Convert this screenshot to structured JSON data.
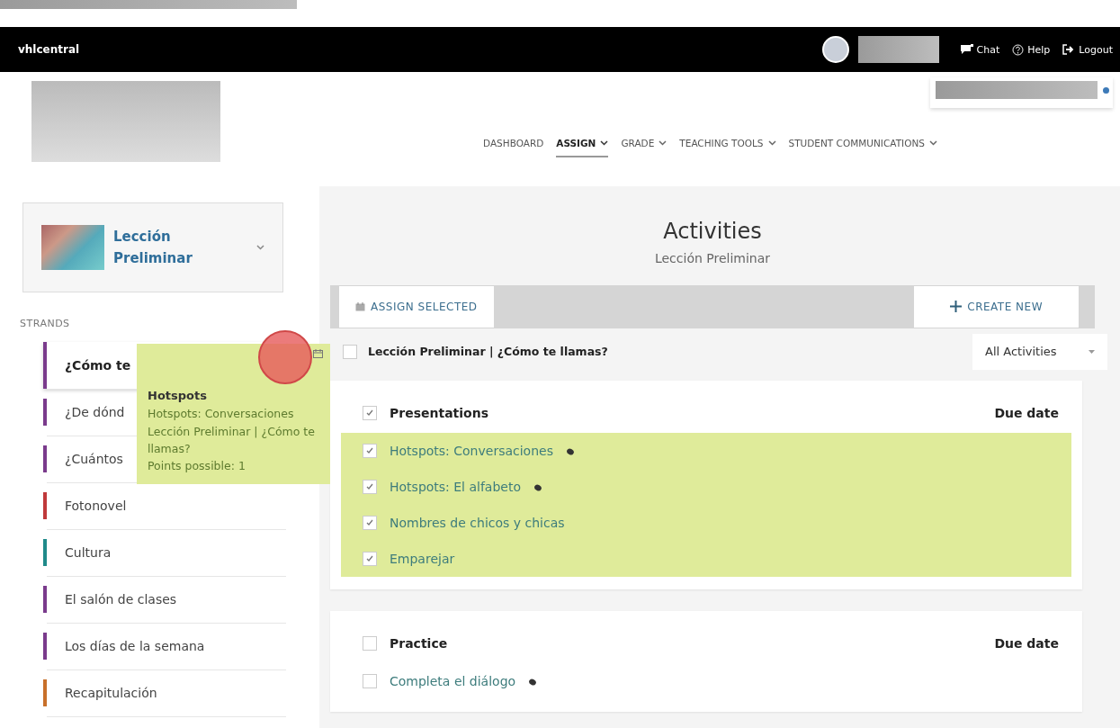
{
  "top_bar": {
    "brand": "vhlcentral",
    "links": [
      {
        "kind": "chat",
        "label": "Chat"
      },
      {
        "kind": "help",
        "label": "Help"
      },
      {
        "kind": "logout",
        "label": "Logout"
      }
    ]
  },
  "nav": [
    {
      "label": "DASHBOARD",
      "selected": false,
      "dropdown": false
    },
    {
      "label": "ASSIGN",
      "selected": true,
      "dropdown": true
    },
    {
      "label": "GRADE",
      "selected": false,
      "dropdown": true
    },
    {
      "label": "TEACHING TOOLS",
      "selected": false,
      "dropdown": true
    },
    {
      "label": "STUDENT COMMUNICATIONS",
      "selected": false,
      "dropdown": true
    }
  ],
  "lesson_picker": {
    "title": "Lección Preliminar"
  },
  "strands": {
    "heading": "STRANDS",
    "items": [
      {
        "label": "¿Cómo te",
        "color": "#7a3b8c",
        "selected": true
      },
      {
        "label": "¿De dónd",
        "color": "#7a3b8c",
        "selected": false
      },
      {
        "label": "¿Cuántos",
        "color": "#7a3b8c",
        "selected": false
      },
      {
        "label": "Fotonovel",
        "color": "#c0393b",
        "selected": false
      },
      {
        "label": "Cultura",
        "color": "#1f8a8a",
        "selected": false
      },
      {
        "label": "El salón de clases",
        "color": "#7a3b8c",
        "selected": false
      },
      {
        "label": "Los días de la semana",
        "color": "#7a3b8c",
        "selected": false
      },
      {
        "label": "Recapitulación",
        "color": "#c8702a",
        "selected": false
      }
    ]
  },
  "tooltip": {
    "title": "Hotspots",
    "lines": [
      "Hotspots: Conversaciones",
      "Lección Preliminar | ¿Cómo te llamas?",
      "Points possible: 1"
    ]
  },
  "page": {
    "title": "Activities",
    "subtitle": "Lección Preliminar"
  },
  "toolbar": {
    "assign_button": "ASSIGN SELECTED",
    "create_button": "CREATE NEW"
  },
  "filter": {
    "breadcrumb": "Lección Preliminar | ¿Cómo te llamas?",
    "checked": false,
    "dropdown": "All Activities"
  },
  "sections": [
    {
      "title": "Presentations",
      "due_label": "Due date",
      "checked": true,
      "items": [
        {
          "label": "Hotspots: Conversaciones",
          "checked": true,
          "selected": true,
          "has_icon": true
        },
        {
          "label": "Hotspots: El alfabeto",
          "checked": true,
          "selected": true,
          "has_icon": true
        },
        {
          "label": "Nombres de chicos y chicas",
          "checked": true,
          "selected": true,
          "has_icon": false
        },
        {
          "label": "Emparejar",
          "checked": true,
          "selected": true,
          "has_icon": false
        }
      ]
    },
    {
      "title": "Practice",
      "due_label": "Due date",
      "checked": false,
      "items": [
        {
          "label": "Completa el diálogo",
          "checked": false,
          "selected": false,
          "has_icon": true
        }
      ]
    }
  ]
}
